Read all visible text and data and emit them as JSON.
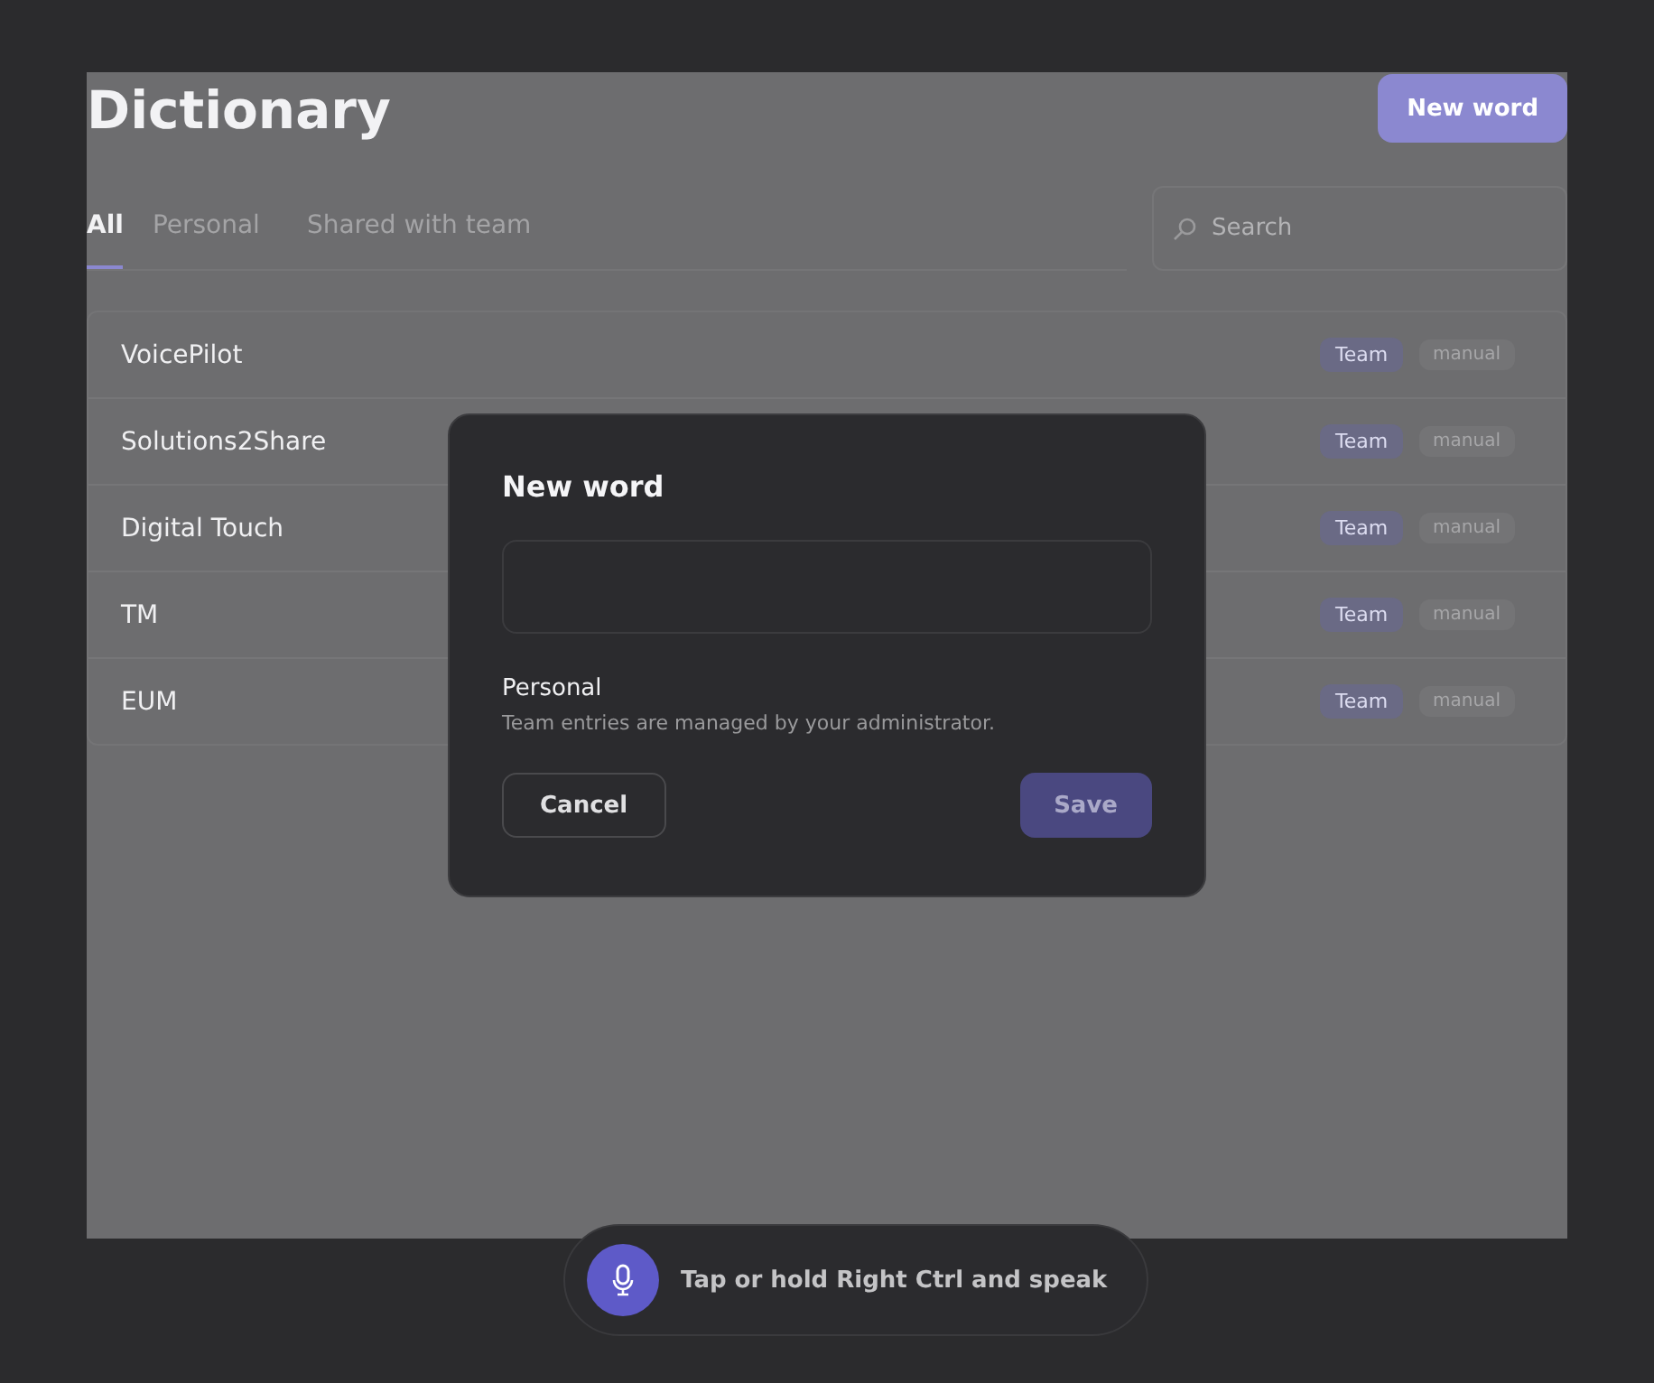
{
  "page": {
    "title": "Dictionary",
    "action": "New word"
  },
  "tabs": [
    {
      "label": "All",
      "selected": true
    },
    {
      "label": "Personal",
      "selected": false
    },
    {
      "label": "Shared with team",
      "selected": false
    }
  ],
  "search": {
    "placeholder": "Search"
  },
  "entries": [
    {
      "word": "VoicePilot",
      "scope": "Team",
      "source": "manual"
    },
    {
      "word": "Solutions2Share",
      "scope": "Team",
      "source": "manual"
    },
    {
      "word": "Digital Touch",
      "scope": "Team",
      "source": "manual"
    },
    {
      "word": "TM",
      "scope": "Team",
      "source": "manual"
    },
    {
      "word": "EUM",
      "scope": "Team",
      "source": "manual"
    }
  ],
  "dialog": {
    "title": "New word",
    "option": "Personal",
    "hint": "Team entries are managed by your administrator.",
    "cancel": "Cancel",
    "save": "Save",
    "save_disabled": true
  },
  "voice_bar": {
    "prompt": "Tap or hold Right Ctrl and speak"
  }
}
